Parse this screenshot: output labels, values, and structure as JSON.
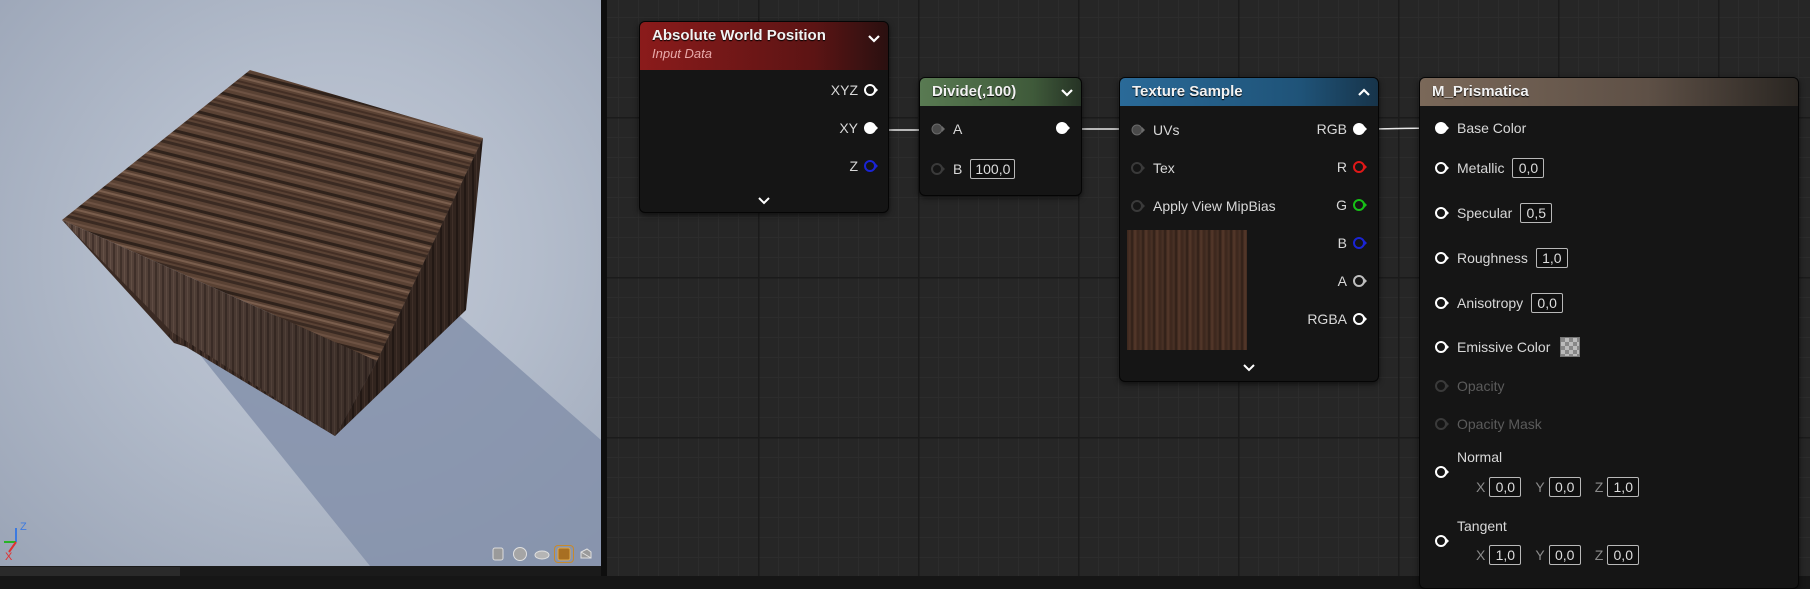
{
  "viewport": {
    "axis": {
      "z": "Z",
      "x": "X"
    },
    "preview_toolbar": {
      "icons": [
        "cylinder-preview-icon",
        "sphere-preview-icon",
        "plane-preview-icon",
        "cube-preview-icon",
        "teapot-preview-icon"
      ],
      "active": "cube-preview-icon"
    }
  },
  "nodes": {
    "absolute_world_position": {
      "title": "Absolute World Position",
      "subtitle": "Input Data",
      "header_color": "#8b1b1b",
      "outputs": {
        "xyz": "XYZ",
        "xy": "XY",
        "z": "Z"
      }
    },
    "divide": {
      "title": "Divide(,100)",
      "header_color": "#52704a",
      "inputs": {
        "a": "A",
        "b": "B"
      },
      "b_value": "100,0"
    },
    "texture_sample": {
      "title": "Texture Sample",
      "header_color": "#1f5d86",
      "inputs": {
        "uvs": "UVs",
        "tex": "Tex",
        "mip": "Apply View MipBias"
      },
      "outputs": {
        "rgb": "RGB",
        "r": "R",
        "g": "G",
        "b": "B",
        "a": "A",
        "rgba": "RGBA"
      }
    },
    "material": {
      "title": "M_Prismatica",
      "header_color": "#6f5f52",
      "base_color": "Base Color",
      "metallic": {
        "label": "Metallic",
        "value": "0,0"
      },
      "specular": {
        "label": "Specular",
        "value": "0,5"
      },
      "roughness": {
        "label": "Roughness",
        "value": "1,0"
      },
      "anisotropy": {
        "label": "Anisotropy",
        "value": "0,0"
      },
      "emissive": "Emissive Color",
      "opacity": "Opacity",
      "opacity_mask": "Opacity Mask",
      "normal": {
        "label": "Normal",
        "x": "0,0",
        "y": "0,0",
        "z": "1,0"
      },
      "tangent": {
        "label": "Tangent",
        "x": "1,0",
        "y": "0,0",
        "z": "0,0"
      },
      "axis_labels": {
        "x": "X",
        "y": "Y",
        "z": "Z"
      }
    }
  },
  "colors": {
    "pin_red": "#e01818",
    "pin_green": "#17c017",
    "pin_blue": "#1a24d4",
    "pin_white": "#ffffff"
  }
}
